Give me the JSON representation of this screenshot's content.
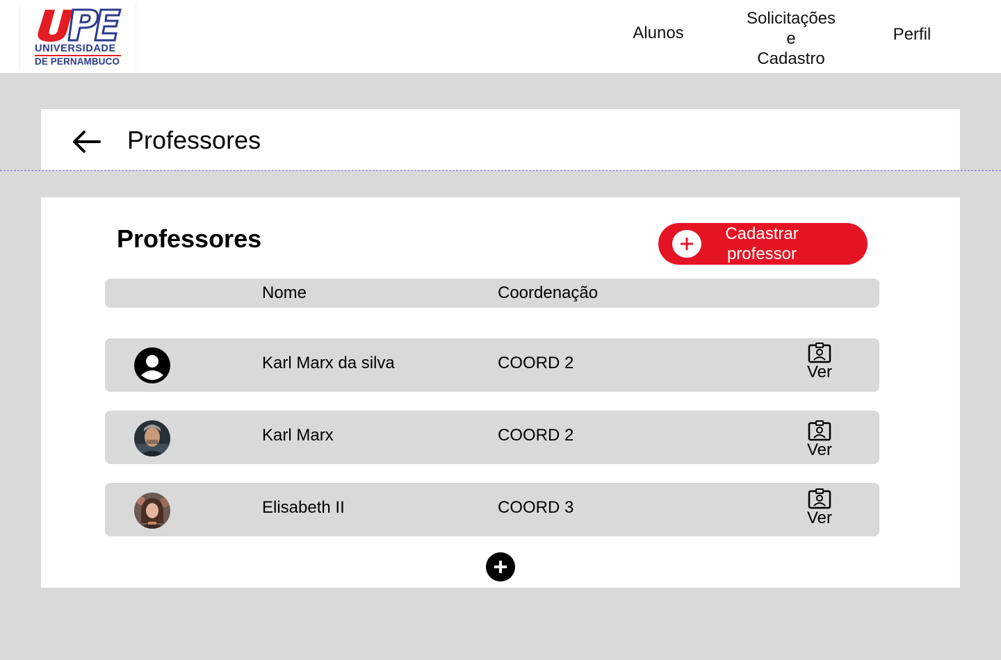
{
  "logo": {
    "line1": "UNIVERSIDADE",
    "line2": "DE PERNAMBUCO",
    "brand_red": "#e31b23",
    "brand_blue": "#2b3a8c"
  },
  "nav": {
    "alunos": "Alunos",
    "solicitacoes": "Solicitações\ne\nCadastro",
    "perfil": "Perfil"
  },
  "header": {
    "title": "Professores",
    "back_icon": "arrow-left-icon"
  },
  "section": {
    "title": "Professores",
    "add_button": "Cadastrar professor",
    "accent": "#e51424"
  },
  "table": {
    "columns": [
      "Nome",
      "Coordenação"
    ],
    "rows": [
      {
        "avatar": "default-user-icon",
        "name": "Karl Marx da silva",
        "coord": "COORD 2",
        "action": "Ver"
      },
      {
        "avatar": "photo",
        "name": "Karl Marx",
        "coord": "COORD 2",
        "action": "Ver"
      },
      {
        "avatar": "photo",
        "name": "Elisabeth II",
        "coord": "COORD 3",
        "action": "Ver"
      }
    ]
  },
  "add_row_icon": "plus-circle-icon"
}
